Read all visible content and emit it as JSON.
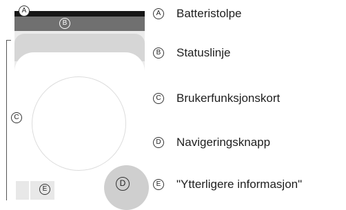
{
  "markers": {
    "a": "A",
    "b": "B",
    "c": "C",
    "d": "D",
    "e": "E"
  },
  "legend": [
    {
      "marker": "A",
      "label": "Batteristolpe"
    },
    {
      "marker": "B",
      "label": "Statuslinje"
    },
    {
      "marker": "C",
      "label": "Brukerfunksjonskort"
    },
    {
      "marker": "D",
      "label": "Navigeringsknapp"
    },
    {
      "marker": "E",
      "label": "\"Ytterligere informasjon\""
    }
  ],
  "colors": {
    "battery_bar": "#161616",
    "status_bar": "#707070",
    "card_header": "#d6d6d6",
    "screen_background": "#ececec",
    "navigation_button": "#cfcfcf",
    "info_block": "#e8e8e8"
  }
}
